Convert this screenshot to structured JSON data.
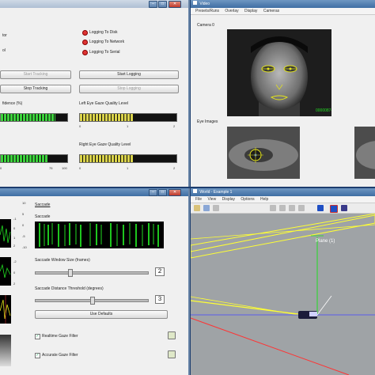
{
  "logging_window": {
    "labels": {
      "monitor": "tor",
      "mode": "ol"
    },
    "log_disk": "Logging To Disk",
    "log_network": "Logging To Network",
    "log_serial": "Logging To Serial",
    "start_tracking": "Start Tracking",
    "stop_tracking": "Stop Tracking",
    "start_logging": "Start Logging",
    "stop_logging": "Stop Logging",
    "confidence_label": "fidence (%)",
    "left_quality_label": "Left Eye Gaze Quality Level",
    "right_quality_label": "Right Eye Gaze Quality Level",
    "left_ticks": [
      "0",
      "1",
      "2"
    ],
    "right_ticks": [
      "0",
      "1",
      "2"
    ],
    "lower_ticks": [
      "0",
      "75",
      "100"
    ],
    "confidence_value": 0.82,
    "lower_value": 0.7,
    "left_quality_value": 0.55,
    "right_quality_value": 0.55
  },
  "video_window": {
    "title": "Video",
    "menu": [
      "Presets/Runs",
      "Overlay",
      "Display",
      "Cameras"
    ],
    "camera_label": "Camera 0",
    "eye_images_label": "Eye Images",
    "overlay_number": "00000874"
  },
  "saccade_window": {
    "section_label": "Saccade",
    "saccade_label": "Saccade",
    "scale_left": [
      "10",
      "5",
      "0",
      "-5",
      "-10"
    ],
    "window_size_label": "Saccade Window Size (frames)",
    "window_size_value": "2",
    "threshold_label": "Saccade Distance Threshold (degrees)",
    "threshold_value": "3",
    "use_defaults": "Use Defaults",
    "realtime_filter": "Realtime Gaze Filter",
    "accurate_filter": "Accurate Gaze Filter",
    "window_size_fraction": 0.3,
    "threshold_fraction": 0.5,
    "side_scale_a": [
      "-1",
      "0",
      "1",
      "2"
    ],
    "side_scale_b": [
      "-2",
      "0",
      "2"
    ]
  },
  "world_window": {
    "title": "World - Example 1",
    "menu": [
      "File",
      "View",
      "Display",
      "Options",
      "Help"
    ],
    "plane_label": "Plane (1)"
  },
  "colors": {
    "desktop": "#1c3d6e",
    "confidence_fill": "#3bd13b",
    "quality_fill": "#d9d24a",
    "scene_bg": "#9fa3a6",
    "yellow_line": "#ffff33",
    "green_line": "#22dd22",
    "red_line": "#ff3333",
    "blue_line": "#4444ff"
  }
}
